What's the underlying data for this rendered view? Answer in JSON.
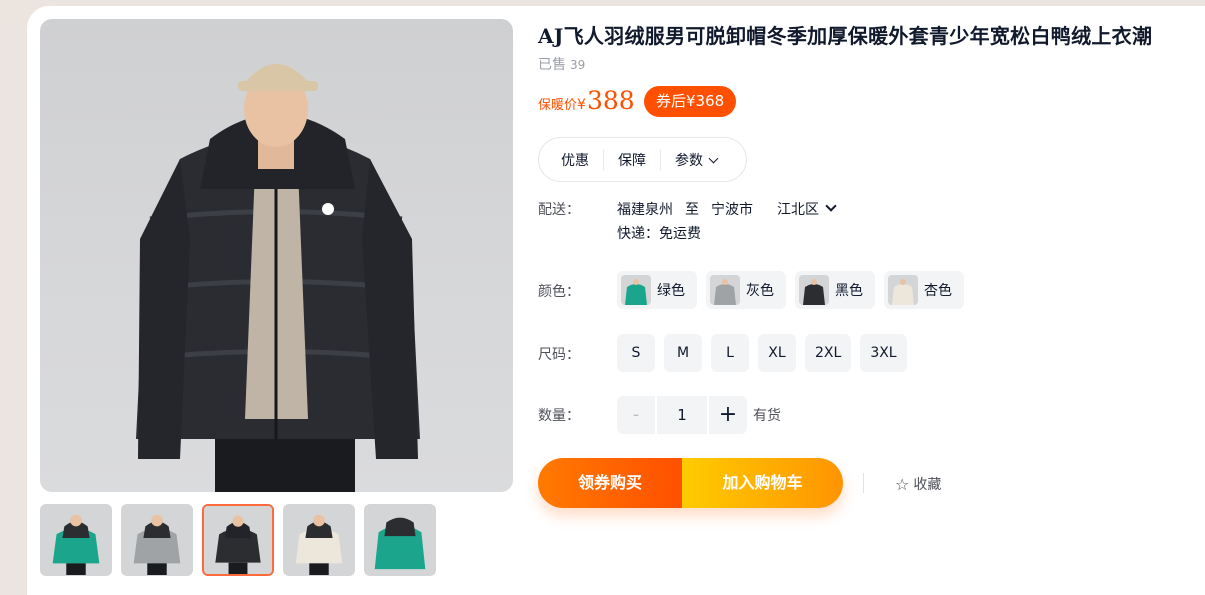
{
  "product": {
    "title": "AJ飞人羽绒服男可脱卸帽冬季加厚保暖外套青少年宽松白鸭绒上衣潮",
    "sold_label": "已售",
    "sold_count": "39",
    "price_label": "保暖价",
    "currency": "¥",
    "price": "388",
    "coupon_price": "券后¥368"
  },
  "tabs": [
    {
      "label": "优惠"
    },
    {
      "label": "保障"
    },
    {
      "label": "参数"
    }
  ],
  "shipping": {
    "label": "配送：",
    "from": "福建泉州",
    "to_word": "至",
    "city": "宁波市",
    "district": "江北区",
    "express": "快递：免运费"
  },
  "colors": {
    "label": "颜色：",
    "options": [
      {
        "name": "绿色",
        "swatch": "#1aa58c"
      },
      {
        "name": "灰色",
        "swatch": "#9fa3a6"
      },
      {
        "name": "黑色",
        "swatch": "#2b2d31"
      },
      {
        "name": "杏色",
        "swatch": "#ece7da"
      }
    ]
  },
  "sizes": {
    "label": "尺码：",
    "options": [
      "S",
      "M",
      "L",
      "XL",
      "2XL",
      "3XL"
    ]
  },
  "quantity": {
    "label": "数量：",
    "minus": "-",
    "value": "1",
    "plus": "+",
    "stock": "有货"
  },
  "actions": {
    "buy": "领券购买",
    "cart": "加入购物车",
    "favorite": "收藏"
  },
  "gallery": {
    "selected_index": 2,
    "thumbnails": [
      "green",
      "gray",
      "black",
      "apricot",
      "green-back"
    ]
  },
  "colors_theme": {
    "accent": "#ff5000",
    "cart_yellow": "#ffcb00"
  }
}
